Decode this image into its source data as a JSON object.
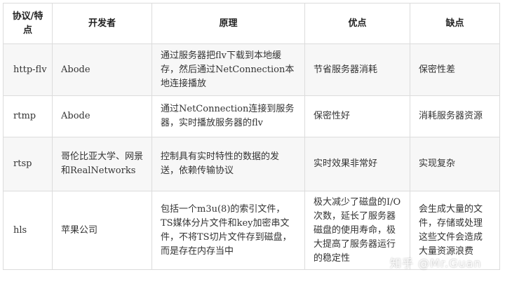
{
  "table": {
    "headers": [
      "协议/特点",
      "开发者",
      "原理",
      "优点",
      "缺点"
    ],
    "rows": [
      {
        "protocol": "http-flv",
        "developer": "Abode",
        "principle": "通过服务器把flv下载到本地缓存，然后通过NetConnection本地连接播放",
        "pros": "节省服务器消耗",
        "cons": "保密性差"
      },
      {
        "protocol": "rtmp",
        "developer": "Abode",
        "principle": "通过NetConnection连接到服务器，实时播放服务器的flv",
        "pros": "保密性好",
        "cons": "消耗服务器资源"
      },
      {
        "protocol": "rtsp",
        "developer": "哥伦比亚大学、网景和RealNetworks",
        "principle": "控制具有实时特性的数据的发送，依赖传输协议",
        "pros": "实时效果非常好",
        "cons": "实现复杂"
      },
      {
        "protocol": "hls",
        "developer": "苹果公司",
        "principle": "包括一个m3u(8)的索引文件，TS媒体分片文件和key加密串文件，不将TS切片文件存到磁盘，而是存在内存当中",
        "pros": "极大减少了磁盘的I/O次数，延长了服务器磁盘的使用寿命，极大提高了服务器运行的稳定性",
        "cons": "会生成大量的文件，存储或处理这些文件会造成大量资源浪费"
      }
    ]
  },
  "watermark": "知乎 @Mr.Guan"
}
